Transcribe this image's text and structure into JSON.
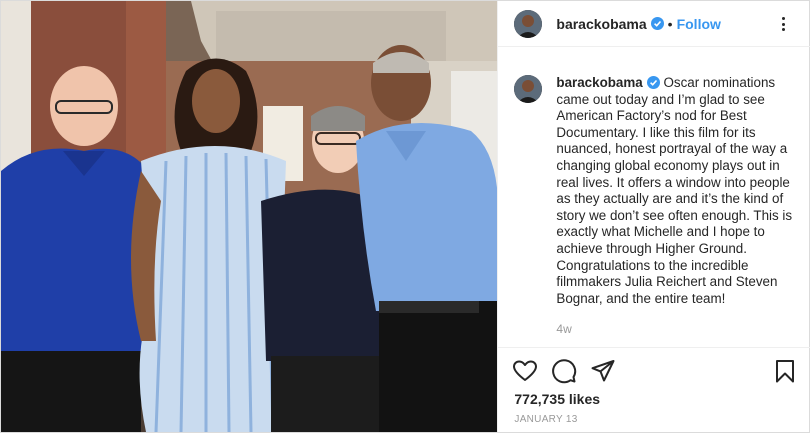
{
  "post": {
    "username": "barackobama",
    "follow_label": "Follow",
    "separator": "•",
    "caption": "Oscar nominations came out today and I’m glad to see American Factory’s nod for Best Documentary. I like this film for its nuanced, honest portrayal of the way a changing global economy plays out in real lives. It offers a window into people as they actually are and it’s the kind of story we don’t see often enough. This is exactly what Michelle and I hope to achieve through Higher Ground. Congratulations to the incredible filmmakers Julia Reichert and Steven Bognar, and the entire team!",
    "time_ago": "4w",
    "likes": "772,735 likes",
    "date": "JANUARY 13"
  },
  "icons": {
    "verified": "verified-badge-icon",
    "more": "more-options-icon",
    "like": "heart-icon",
    "comment": "comment-icon",
    "share": "share-icon",
    "save": "bookmark-icon"
  },
  "colors": {
    "accent": "#3897f0",
    "text": "#262626",
    "muted": "#999999",
    "border": "#efefef"
  }
}
